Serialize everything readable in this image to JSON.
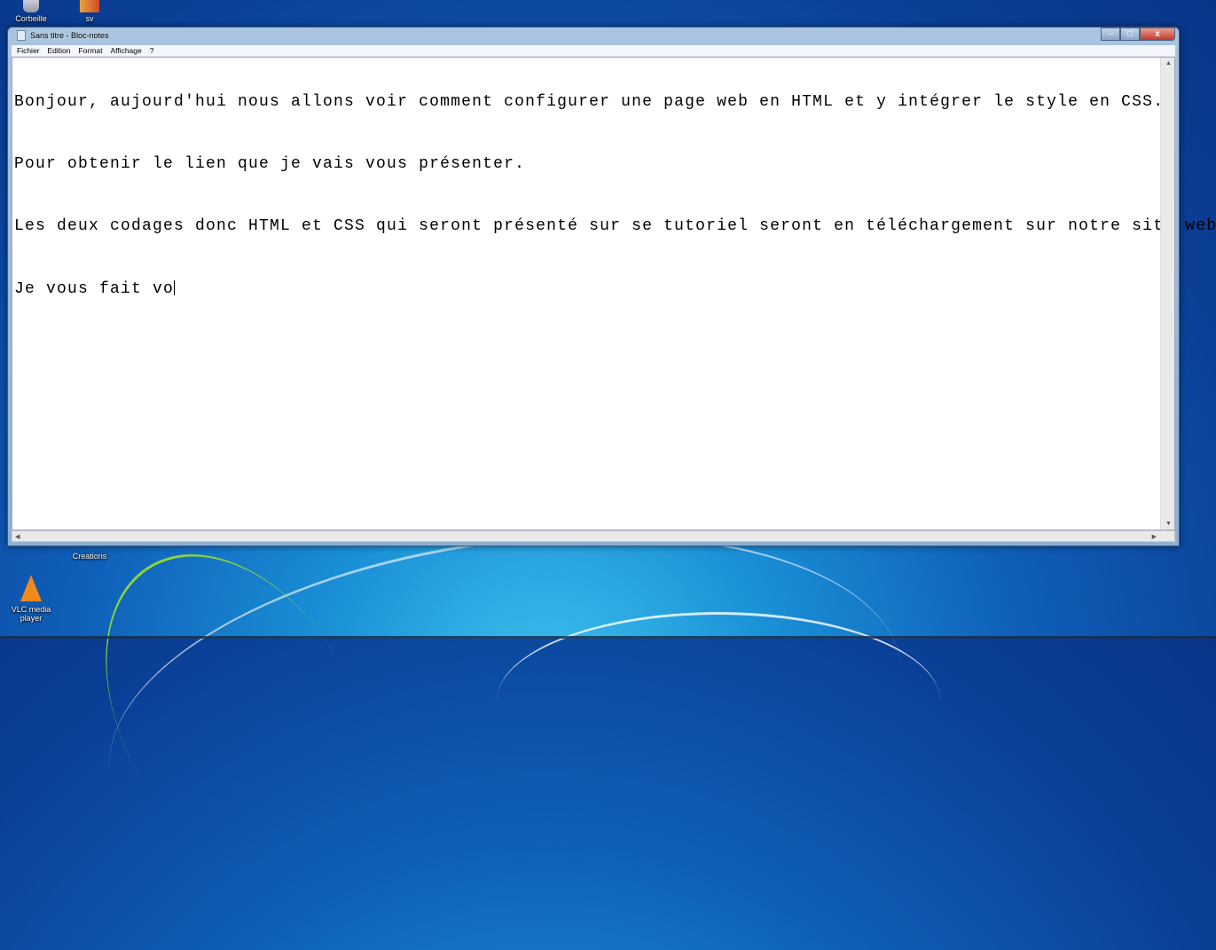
{
  "desktop": {
    "icons": [
      {
        "label": "Corbeille"
      },
      {
        "label": "sv"
      },
      {
        "label": "Creations"
      },
      {
        "label": "VLC media player"
      }
    ]
  },
  "window": {
    "title": "Sans titre - Bloc-notes",
    "controls": {
      "minimize": "–",
      "maximize": "□",
      "close": "x"
    },
    "menu": [
      "Fichier",
      "Edition",
      "Format",
      "Affichage",
      "?"
    ],
    "lines": [
      "Bonjour, aujourd'hui nous allons voir comment configurer une page web en HTML et y intégrer le style en CSS.",
      "Pour obtenir le lien que je vais vous présenter.",
      "Les deux codages donc HTML et CSS qui seront présenté sur se tutoriel seront en téléchargement sur notre site web .",
      "Je vous fait vo"
    ]
  }
}
